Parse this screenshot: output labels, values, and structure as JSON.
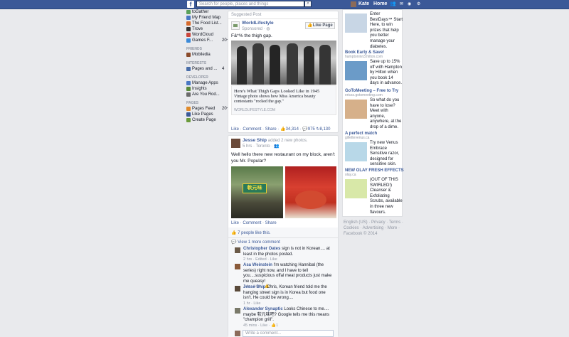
{
  "topbar": {
    "logo": "f",
    "search_placeholder": "Search for people, places and things",
    "user_name": "Kate",
    "home_label": "Home"
  },
  "left_nav": {
    "apps": [
      {
        "label": "toGather",
        "color": "#5ba15a"
      },
      {
        "label": "My Friend Map",
        "color": "#4a78c4"
      },
      {
        "label": "The Food List...",
        "color": "#d66a2c"
      },
      {
        "label": "Trove",
        "color": "#333333"
      },
      {
        "label": "WordCloud",
        "color": "#c9463d"
      },
      {
        "label": "Games F...",
        "color": "#3b8ad8",
        "count": "20+"
      }
    ],
    "friends_heading": "FRIENDS",
    "friends": [
      {
        "label": "Mobiledia",
        "color": "#8a4a2a"
      }
    ],
    "interests_heading": "INTERESTS",
    "interests": [
      {
        "label": "Pages and ...",
        "color": "#4a6ea9",
        "count": "4"
      }
    ],
    "developer_heading": "DEVELOPER",
    "developer": [
      {
        "label": "Manage Apps",
        "color": "#4a78c4"
      },
      {
        "label": "Insights",
        "color": "#5a8a3a"
      },
      {
        "label": "Are You Rod...",
        "color": "#6a6a6a"
      }
    ],
    "pages_heading": "PAGES",
    "pages": [
      {
        "label": "Pages Feed",
        "color": "#e08a2a",
        "count": "20+"
      },
      {
        "label": "Like Pages",
        "color": "#3b5998"
      },
      {
        "label": "Create Page",
        "color": "#6a9a3a"
      }
    ]
  },
  "suggested_post": {
    "header": "Suggested Post",
    "page_name": "WorldLifestyle",
    "sponsored": "Sponsored · ",
    "like_page_button": "Like Page",
    "text": "F&*% the thigh gap.",
    "link_title": "Here's What Thigh Gaps Looked Like in 1945",
    "link_desc": "Vintage photo shows how Miss America beauty contestants \"rocked the gap.\"",
    "link_domain": "WORLDLIFESTYLE.COM",
    "actions": {
      "like": "Like",
      "comment": "Comment",
      "share": "Share"
    },
    "stats": {
      "likes": "34,314",
      "comments": "975",
      "shares": "8,130"
    }
  },
  "photo_post": {
    "author": "Jesse Ship",
    "action_text": "added 2 new photos.",
    "time": "5 hrs",
    "location": "Toronto",
    "text": "Well hello there new restaurant on my block, aren't you Mr. Popular?",
    "sign_text": "軟元味",
    "actions": {
      "like": "Like",
      "comment": "Comment",
      "share": "Share"
    },
    "likes_text": "7 people like this.",
    "view_more": "View 1 more comment",
    "comments": [
      {
        "author": "Christopher Oates",
        "text": "sign is not in Korean.... at least in the photos posted.",
        "meta": "2 hrs · Edited · ",
        "like": "Like",
        "color": "#6b5a48"
      },
      {
        "author": "Asa Weinstein",
        "text": "I'm watching Hannibal (the series) right now, and I have to tell you....suspicious offal meat products just make me queasy!",
        "meta": "1 hr · ",
        "like": "Like",
        "likes": "1",
        "color": "#8a5a3a"
      },
      {
        "author": "Jesse Ship",
        "text": "Chris, Korean friend told me the hanging street sign is in Korea but food one isn't. He could be wrong....",
        "meta": "1 hr · ",
        "like": "Like",
        "color": "#5a4a3a"
      },
      {
        "author": "Alexander Synaptic",
        "text": "Looks Chinese to me.... maybe 软元味吧? Google tells me this means \"champion grill\".",
        "meta": "45 mins · ",
        "like": "Like",
        "likes": "1",
        "color": "#7a7a6a"
      }
    ],
    "write_placeholder": "Write a comment..."
  },
  "ads": [
    {
      "title": "",
      "url": "",
      "text": "Enter BestDays™ Start Here, to win prizes that help you better manage your diabetes.",
      "color": "#c8d6e5"
    },
    {
      "title": "Book Early & Save!",
      "url": "hamptoninn3.hilton.com",
      "text": "Save up to 15% off with Hampton by Hilton when you book 14 days in advance.",
      "color": "#6b9bc8"
    },
    {
      "title": "GoToMeeting – Free to Try",
      "url": "ericss.gotomeeting.com",
      "text": "So what do you have to lose? Meet with anyone, anywhere, at the drop of a dime.",
      "color": "#d6b08a"
    },
    {
      "title": "A perfect match",
      "url": "gillettevenus.ca",
      "text": "Try new Venus Embrace Sensitive razor, designed for sensitive skin.",
      "color": "#b8d8e8"
    },
    {
      "title": "NEW OLAY FRESH EFFECTS",
      "url": "olay.ca",
      "text": "(OUT OF THIS SWIRLED!) Cleanser & Exfoliating Scrubs, available in three new flavours.",
      "color": "#d8e8a8"
    }
  ],
  "footer": {
    "line1": "English (US) · Privacy · Terms ·",
    "line2": "Cookies · Advertising · More ·",
    "line3": "Facebook © 2014"
  }
}
